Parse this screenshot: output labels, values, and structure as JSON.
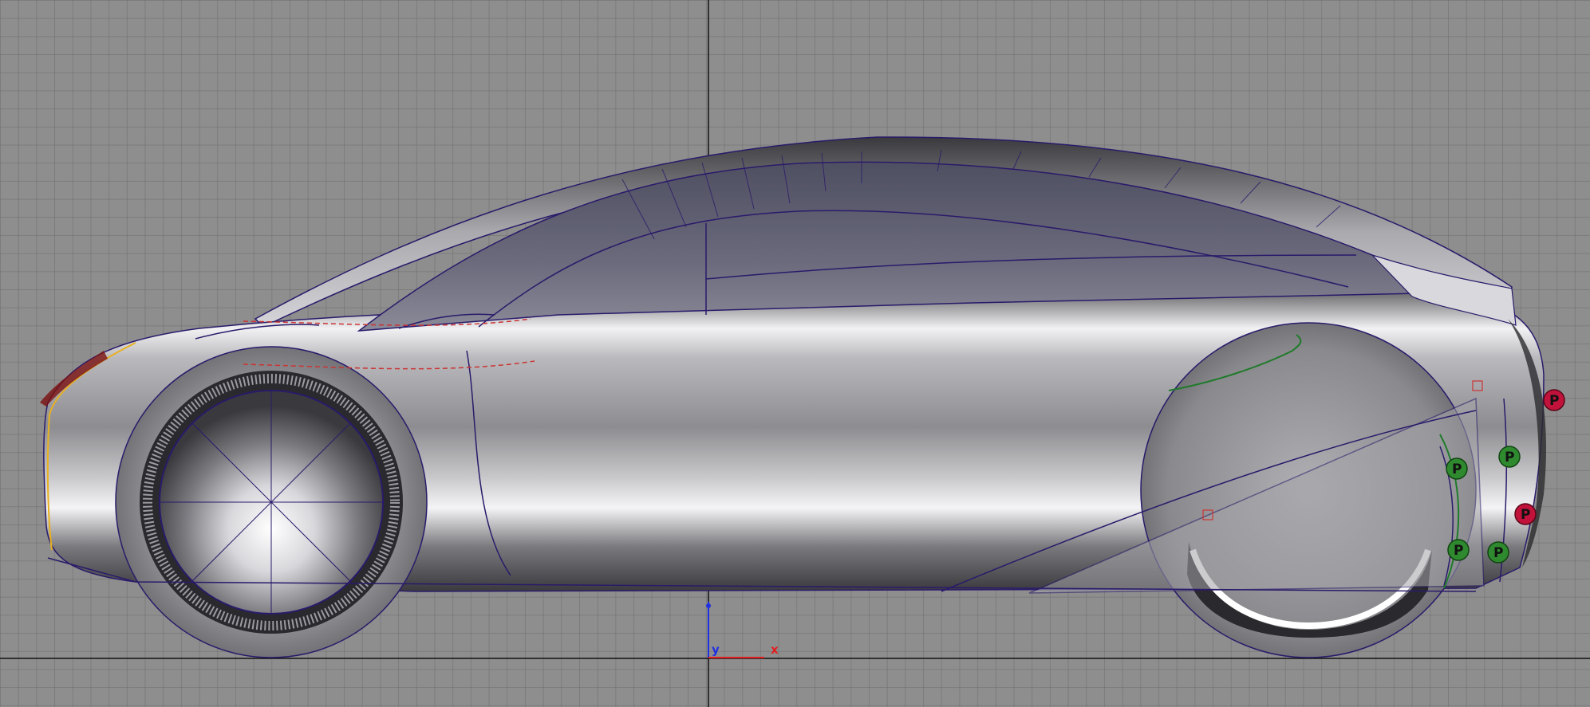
{
  "viewport": {
    "background": "#8e8e8e",
    "grid_color": "#6e6e6e",
    "axis_color": "#111111"
  },
  "gizmo": {
    "x_label": "x",
    "y_label": "y",
    "x_color": "#e02020",
    "y_color": "#2030e0"
  },
  "handles": {
    "green_label": "P",
    "red_label": "P",
    "green_color": "#2f8a2f",
    "red_color": "#c0123a"
  },
  "curve_colors": {
    "structure": "#2a1a6a",
    "highlight_red": "#cc3333",
    "highlight_green": "#1f7a2a",
    "highlight_yellow": "#e8b020"
  }
}
